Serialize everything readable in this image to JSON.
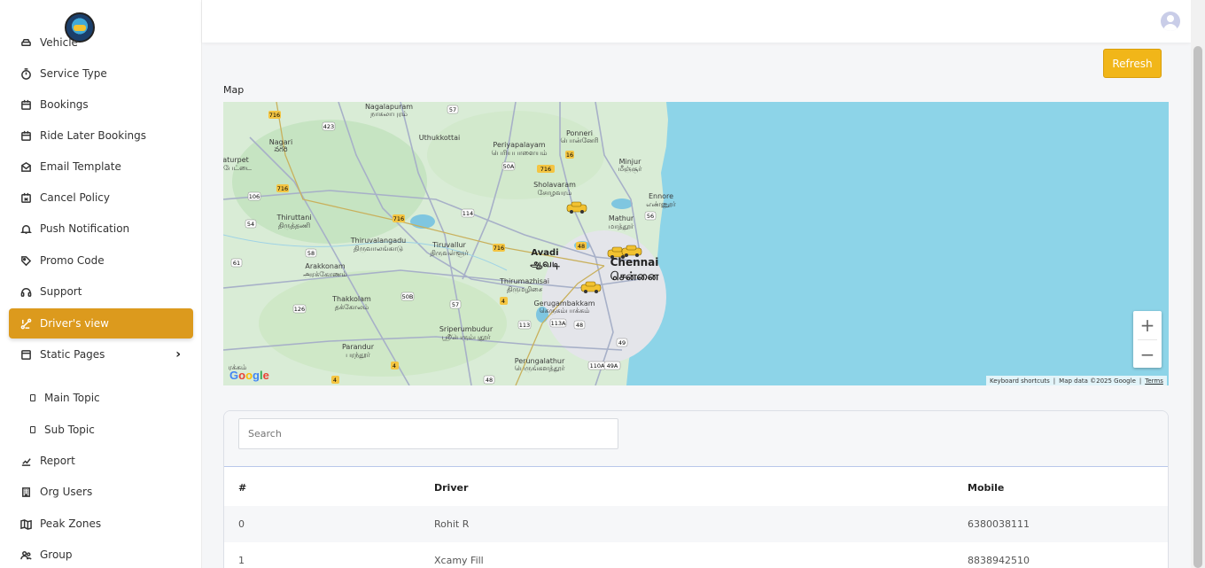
{
  "sidebar": {
    "items": [
      {
        "label": "Vehicle",
        "icon": "car-icon"
      },
      {
        "label": "Service Type",
        "icon": "timer-icon"
      },
      {
        "label": "Bookings",
        "icon": "calendar-icon"
      },
      {
        "label": "Ride Later Bookings",
        "icon": "calendar-icon"
      },
      {
        "label": "Email Template",
        "icon": "mail-icon"
      },
      {
        "label": "Cancel Policy",
        "icon": "calendar-x-icon"
      },
      {
        "label": "Push Notification",
        "icon": "bell-icon"
      },
      {
        "label": "Promo Code",
        "icon": "tag-icon"
      },
      {
        "label": "Support",
        "icon": "headset-icon"
      },
      {
        "label": "Driver's view",
        "icon": "route-icon",
        "active": true
      },
      {
        "label": "Static Pages",
        "icon": "page-icon",
        "expandable": true
      },
      {
        "label": "Main Topic",
        "icon": "square-icon",
        "sub": true
      },
      {
        "label": "Sub Topic",
        "icon": "square-icon",
        "sub": true
      },
      {
        "label": "Report",
        "icon": "chart-icon"
      },
      {
        "label": "Org Users",
        "icon": "building-icon"
      },
      {
        "label": "Peak Zones",
        "icon": "map-icon"
      },
      {
        "label": "Group",
        "icon": "group-icon"
      }
    ]
  },
  "main": {
    "refresh_label": "Refresh",
    "map_label": "Map",
    "map": {
      "places": [
        {
          "name": "Nagalapuram",
          "local": "நாகலாபுரம்"
        },
        {
          "name": "Uthukkottai"
        },
        {
          "name": "Periyapalayam",
          "local": "பெரியபாளையம்"
        },
        {
          "name": "Ponneri",
          "local": "பொன்னேரி"
        },
        {
          "name": "Minjur",
          "local": "மீஞ்சூர்"
        },
        {
          "name": "Nagari",
          "local": "నగరి"
        },
        {
          "name": "aturpet",
          "local": "ர்பேட்டை"
        },
        {
          "name": "Sholavaram",
          "local": "சோழவரம்"
        },
        {
          "name": "Ennore",
          "local": "எண்ணூர்"
        },
        {
          "name": "Thiruttani",
          "local": "திருத்தணி"
        },
        {
          "name": "Mathur",
          "local": "மாத்தூர்"
        },
        {
          "name": "Thiruvalangadu",
          "local": "திருவாலங்காடு"
        },
        {
          "name": "Tiruvallur",
          "local": "திருவள்ளூர்"
        },
        {
          "name": "Avadi",
          "local": "ஆவடி"
        },
        {
          "name": "Chennai",
          "local": "சென்னை"
        },
        {
          "name": "Arakkonam",
          "local": "அரக்கோணம்"
        },
        {
          "name": "Thirumazhisai",
          "local": "திருமழிசை"
        },
        {
          "name": "Thakkolam",
          "local": "தக்கோலம்"
        },
        {
          "name": "Gerugambakkam",
          "local": "கெருகம்பாக்கம்"
        },
        {
          "name": "Sriperumbudur",
          "local": "ஸ்ரீபெரும்புதூர்"
        },
        {
          "name": "Parandur",
          "local": "பரந்தூர்"
        },
        {
          "name": "Perungalathur",
          "local": "பெருங்களத்தூர்"
        },
        {
          "name": "",
          "local": "ரக்கம்"
        }
      ],
      "road_shields": [
        "716",
        "423",
        "57",
        "716",
        "716",
        "16",
        "106",
        "716",
        "114",
        "50A",
        "56",
        "54",
        "716",
        "48",
        "61",
        "58",
        "126",
        "50B",
        "57",
        "4",
        "113",
        "113A",
        "48",
        "49",
        "4",
        "4",
        "48",
        "110A",
        "49A"
      ],
      "zoom_in": "+",
      "zoom_out": "−",
      "google_logo": "Google",
      "footer": {
        "shortcuts": "Keyboard shortcuts",
        "attribution": "Map data ©2025 Google",
        "terms": "Terms"
      }
    },
    "search_placeholder": "Search",
    "table": {
      "headers": [
        "#",
        "Driver",
        "Mobile"
      ],
      "rows": [
        {
          "index": "0",
          "driver": "Rohit R",
          "mobile": "6380038111"
        },
        {
          "index": "1",
          "driver": "Xcamy Fill",
          "mobile": "8838942510"
        }
      ]
    }
  }
}
